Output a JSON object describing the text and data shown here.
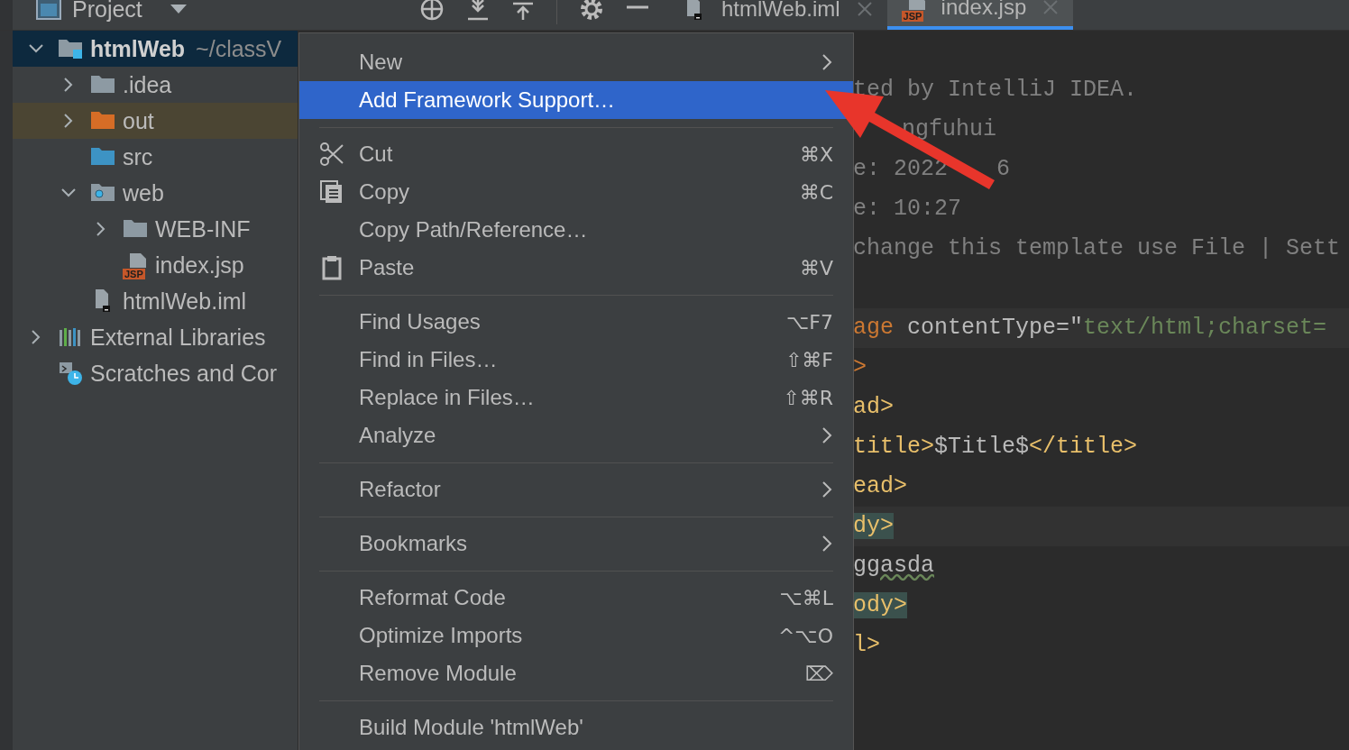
{
  "project_panel": {
    "title": "Project",
    "tree": [
      {
        "label": "htmlWeb",
        "path": "~/classV",
        "kind": "module",
        "expanded": true,
        "selected": true,
        "children": [
          {
            "label": ".idea",
            "kind": "folder",
            "expanded": false,
            "selected": false
          },
          {
            "label": "out",
            "kind": "excluded-folder",
            "expanded": false,
            "selected": false
          },
          {
            "label": "src",
            "kind": "source-folder",
            "selected": false
          },
          {
            "label": "web",
            "kind": "web-folder",
            "expanded": true,
            "selected": false,
            "children": [
              {
                "label": "WEB-INF",
                "kind": "folder",
                "expanded": false,
                "selected": false
              },
              {
                "label": "index.jsp",
                "kind": "jsp-file",
                "badge": "JSP",
                "selected": false
              }
            ]
          },
          {
            "label": "htmlWeb.iml",
            "kind": "iml-file",
            "selected": false
          }
        ]
      },
      {
        "label": "External Libraries",
        "kind": "libraries",
        "expanded": false,
        "selected": false
      },
      {
        "label": "Scratches and Cor",
        "kind": "scratches",
        "selected": false
      }
    ]
  },
  "tabs": [
    {
      "label": "htmlWeb.iml",
      "kind": "iml-file",
      "selected": false
    },
    {
      "label": "index.jsp",
      "kind": "jsp-file",
      "badge": "JSP",
      "selected": true
    }
  ],
  "context_menu": {
    "items": [
      {
        "kind": "item",
        "label": "New",
        "submenu": true,
        "selected": false
      },
      {
        "kind": "item",
        "label": "Add Framework Support…",
        "selected": true
      },
      {
        "kind": "separator"
      },
      {
        "kind": "scissors-item",
        "label": "Cut",
        "shortcut": "⌘X",
        "selected": false
      },
      {
        "kind": "pages-item",
        "label": "Copy",
        "shortcut": "⌘C",
        "selected": false
      },
      {
        "kind": "item",
        "label": "Copy Path/Reference…",
        "selected": false
      },
      {
        "kind": "clipboard-item",
        "label": "Paste",
        "shortcut": "⌘V",
        "selected": false
      },
      {
        "kind": "separator"
      },
      {
        "kind": "item",
        "label": "Find Usages",
        "shortcut": "⌥F7",
        "selected": false
      },
      {
        "kind": "item",
        "label": "Find in Files…",
        "shortcut": "⇧⌘F",
        "selected": false
      },
      {
        "kind": "item",
        "label": "Replace in Files…",
        "shortcut": "⇧⌘R",
        "selected": false
      },
      {
        "kind": "item",
        "label": "Analyze",
        "submenu": true,
        "selected": false
      },
      {
        "kind": "separator"
      },
      {
        "kind": "item",
        "label": "Refactor",
        "submenu": true,
        "selected": false
      },
      {
        "kind": "separator"
      },
      {
        "kind": "item",
        "label": "Bookmarks",
        "submenu": true,
        "selected": false
      },
      {
        "kind": "separator"
      },
      {
        "kind": "item",
        "label": "Reformat Code",
        "shortcut": "⌥⌘L",
        "selected": false
      },
      {
        "kind": "item",
        "label": "Optimize Imports",
        "shortcut": "^⌥O",
        "selected": false
      },
      {
        "kind": "item",
        "label": "Remove Module",
        "shortcut": "⌦",
        "selected": false
      },
      {
        "kind": "separator"
      },
      {
        "kind": "item",
        "label": "Build Module 'htmlWeb'",
        "selected": false
      }
    ]
  },
  "editor": {
    "lines": [
      {
        "tokens": [
          {
            "kind": "comment",
            "text": "ted by IntelliJ IDEA."
          }
        ]
      },
      {
        "tokens": [
          {
            "kind": "comment-after-gap",
            "text": "ngfuhui"
          }
        ]
      },
      {
        "tokens": [
          {
            "kind": "comment",
            "text": "e: 2022"
          },
          {
            "kind": "comment-after-gap",
            "text": "6"
          }
        ]
      },
      {
        "tokens": [
          {
            "kind": "comment",
            "text": "e: 10:27"
          }
        ]
      },
      {
        "tokens": [
          {
            "kind": "comment",
            "text": "change this template use File | Sett"
          }
        ]
      },
      {
        "kind": "blank"
      },
      {
        "highlighted": true,
        "tokens": [
          {
            "kind": "directive",
            "text": "age"
          },
          {
            "kind": "plain",
            "text": " contentType=\""
          },
          {
            "kind": "string",
            "text": "text/html;charset="
          }
        ]
      },
      {
        "tokens": [
          {
            "kind": "directive",
            "text": ">"
          }
        ]
      },
      {
        "tokens": [
          {
            "kind": "tag",
            "text": "ad>"
          }
        ]
      },
      {
        "tokens": [
          {
            "kind": "tag",
            "text": "title>"
          },
          {
            "kind": "plain",
            "text": "$Title$"
          },
          {
            "kind": "tag",
            "text": "</title>"
          }
        ]
      },
      {
        "tokens": [
          {
            "kind": "tag",
            "text": "ead>"
          }
        ]
      },
      {
        "highlighted": true,
        "tokens": [
          {
            "kind": "matched-tag",
            "text": "dy>"
          }
        ]
      },
      {
        "tokens": [
          {
            "kind": "typo",
            "text": "ggasda"
          }
        ]
      },
      {
        "tokens": [
          {
            "kind": "matched-tag",
            "text": "ody>"
          }
        ]
      },
      {
        "tokens": [
          {
            "kind": "tag",
            "text": "l>"
          }
        ]
      }
    ]
  }
}
